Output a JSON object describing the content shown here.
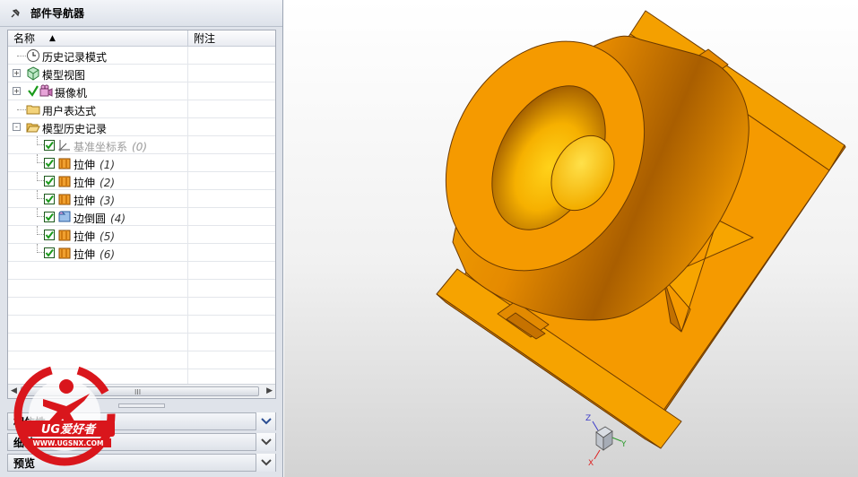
{
  "panel": {
    "title": "部件导航器",
    "columns": {
      "name": "名称",
      "note": "附注"
    }
  },
  "tree": [
    {
      "label": "历史记录模式",
      "suffix": "",
      "icon": "clock-icon",
      "indent": 0,
      "expander": "",
      "check": false,
      "dim": false
    },
    {
      "label": "模型视图",
      "suffix": "",
      "icon": "model-views-icon",
      "indent": 0,
      "expander": "+",
      "check": false,
      "dim": false
    },
    {
      "label": "摄像机",
      "suffix": "",
      "icon": "camera-icon",
      "indent": 0,
      "expander": "+",
      "check": true,
      "dim": false
    },
    {
      "label": "用户表达式",
      "suffix": "",
      "icon": "folder-icon",
      "indent": 0,
      "expander": "",
      "check": false,
      "dim": false
    },
    {
      "label": "模型历史记录",
      "suffix": "",
      "icon": "folder-open-icon",
      "indent": 0,
      "expander": "-",
      "check": false,
      "dim": false
    },
    {
      "label": "基准坐标系",
      "suffix": "(0)",
      "icon": "datum-csys-icon",
      "indent": 1,
      "expander": "",
      "check": true,
      "dim": true
    },
    {
      "label": "拉伸",
      "suffix": "(1)",
      "icon": "extrude-icon",
      "indent": 1,
      "expander": "",
      "check": true,
      "dim": false
    },
    {
      "label": "拉伸",
      "suffix": "(2)",
      "icon": "extrude-icon",
      "indent": 1,
      "expander": "",
      "check": true,
      "dim": false
    },
    {
      "label": "拉伸",
      "suffix": "(3)",
      "icon": "extrude-icon",
      "indent": 1,
      "expander": "",
      "check": true,
      "dim": false
    },
    {
      "label": "边倒圆",
      "suffix": "(4)",
      "icon": "edge-blend-icon",
      "indent": 1,
      "expander": "",
      "check": true,
      "dim": false
    },
    {
      "label": "拉伸",
      "suffix": "(5)",
      "icon": "extrude-icon",
      "indent": 1,
      "expander": "",
      "check": true,
      "dim": false
    },
    {
      "label": "拉伸",
      "suffix": "(6)",
      "icon": "extrude-icon",
      "indent": 1,
      "expander": "",
      "check": true,
      "dim": false
    }
  ],
  "empty_rows": 7,
  "sections": [
    {
      "label": "相依性"
    },
    {
      "label": "细节"
    },
    {
      "label": "预览"
    }
  ],
  "watermark": {
    "brand": "UG爱好者",
    "url": "WWW.UGSNX.COM"
  },
  "triad": {
    "z": "Z",
    "y": "Y",
    "x": "X"
  },
  "colors": {
    "part": "#f59a00",
    "panel": "#dfe3ea",
    "logo_red": "#d9161c"
  }
}
